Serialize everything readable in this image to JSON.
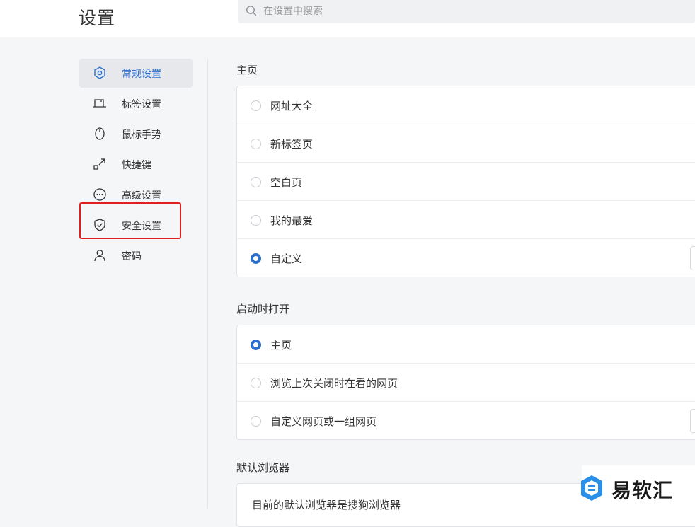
{
  "header": {
    "title": "设置",
    "search_placeholder": "在设置中搜索"
  },
  "sidebar": {
    "items": [
      {
        "label": "常规设置",
        "icon": "gear-hexagon-icon",
        "active": true
      },
      {
        "label": "标签设置",
        "icon": "tab-icon",
        "active": false
      },
      {
        "label": "鼠标手势",
        "icon": "mouse-icon",
        "active": false
      },
      {
        "label": "快捷键",
        "icon": "shortcut-arrow-icon",
        "active": false
      },
      {
        "label": "高级设置",
        "icon": "more-dots-icon",
        "active": false
      },
      {
        "label": "安全设置",
        "icon": "shield-icon",
        "active": false
      },
      {
        "label": "密码",
        "icon": "user-icon",
        "active": false
      }
    ]
  },
  "homepage": {
    "title": "主页",
    "options": [
      "网址大全",
      "新标签页",
      "空白页",
      "我的最爱",
      "自定义"
    ],
    "selected": "自定义"
  },
  "startup": {
    "title": "启动时打开",
    "options": [
      "主页",
      "浏览上次关闭时在看的网页",
      "自定义网页或一组网页"
    ],
    "selected": "主页"
  },
  "default_browser": {
    "title": "默认浏览器",
    "text": "目前的默认浏览器是搜狗浏览器"
  },
  "watermark": {
    "text": "易软汇"
  },
  "colors": {
    "accent": "#2b6fce",
    "highlight": "#e02020"
  }
}
